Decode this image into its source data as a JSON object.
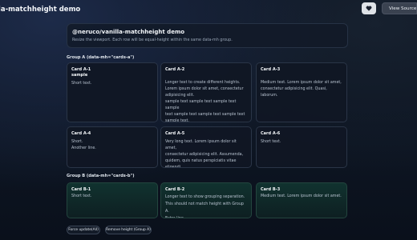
{
  "app": {
    "title": "lla-matchheight demo"
  },
  "toolbar": {
    "source_label": "View Source Code",
    "heart_icon": "heart-icon"
  },
  "hero": {
    "title": "@neruco/vanilla-matchheight demo",
    "subtitle": "Resize the viewport. Each row will be equal-height within the same data-mh group."
  },
  "groups": {
    "a": {
      "label": "Group A (data-mh=\"cards-a\")",
      "cards": [
        {
          "title": "Card A-1\nsample",
          "body": "Short text."
        },
        {
          "title": "Card A-2",
          "body": "Longer text to create different heights.\nLorem ipsum dolor sit amet, consectetur\nadipisicing elit.\nsample text sample text sample text sample\ntext sample text sample text sample text\nsample text."
        },
        {
          "title": "Card A-3",
          "body": "Medium text. Lorem ipsum dolor sit amet,\nconsectetur adipisicing elit. Quasi, laborum."
        },
        {
          "title": "Card A-4",
          "body": "Short.\nAnother line."
        },
        {
          "title": "Card A-5",
          "body": "Very long text. Lorem ipsum dolor sit amet,\nconsectetur adipisicing elit. Assumenda,\nquidem, quis natus perspiciatis vitae eligendi\nminus. Even more lines here."
        },
        {
          "title": "Card A-6",
          "body": "Short text."
        }
      ]
    },
    "b": {
      "label": "Group B (data-mh=\"cards-b\")",
      "cards": [
        {
          "title": "Card B-1",
          "body": "Short text."
        },
        {
          "title": "Card B-2",
          "body": "Longer text to show grouping separation.\nThis should not match height with Group A.\nExtra line."
        },
        {
          "title": "Card B-3",
          "body": "Medium text. Lorem ipsum dolor sit amet."
        }
      ]
    }
  },
  "actions": {
    "force_update": "Force update(All)",
    "remove_height": "Remove height (Group A)"
  }
}
